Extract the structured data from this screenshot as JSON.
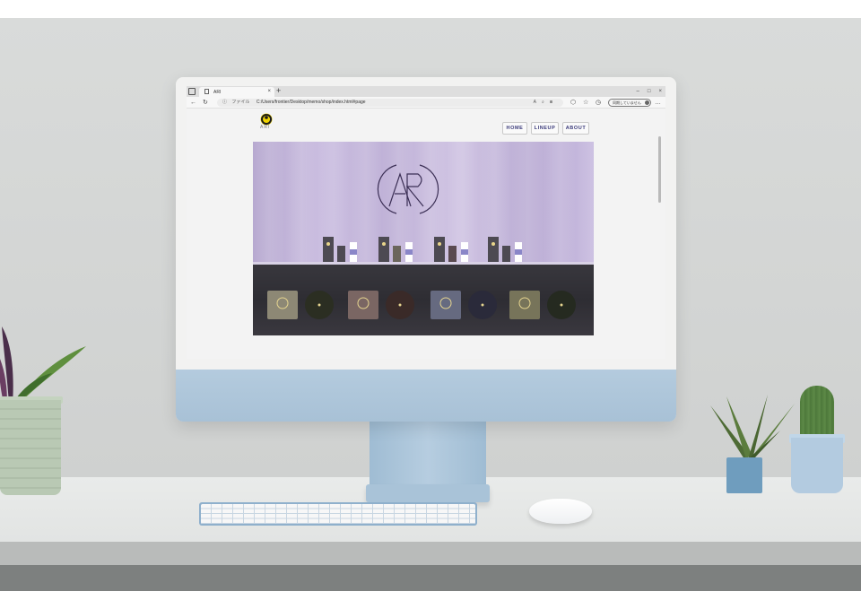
{
  "browser": {
    "tab_title": "ARI",
    "tab_close": "×",
    "new_tab": "+",
    "window_controls": [
      "–",
      "□",
      "×"
    ],
    "address_label": "ファイル",
    "url": "C:/Users/frontier/Desktop/memo/shop/index.html#page",
    "sync_label": "同期していません"
  },
  "site": {
    "logo_text": "ARI",
    "nav": [
      "HOME",
      "LINEUP",
      "ABOUT"
    ]
  },
  "colors": {
    "accent_nav": "#3a3a7a",
    "hero_wall": "#c6b9de",
    "hero_floor": "#2e2d33",
    "monitor": "#b4cbde",
    "logo_yellow": "#f0d400"
  }
}
